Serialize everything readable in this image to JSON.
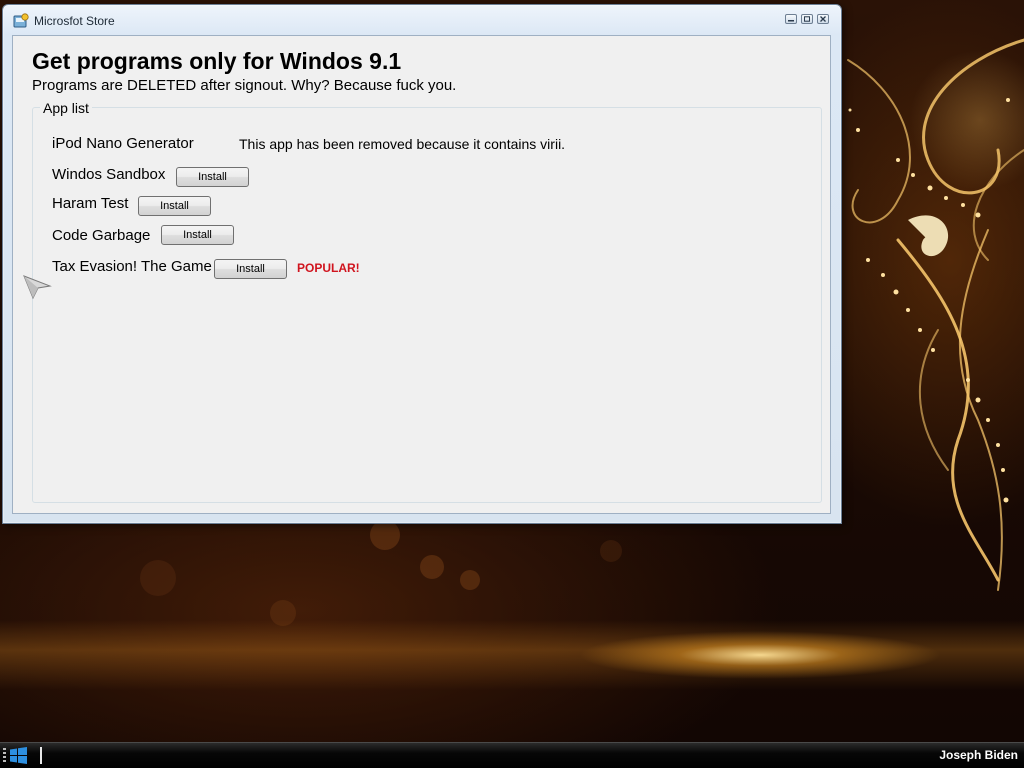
{
  "window": {
    "title": "Microsfot Store",
    "heading": "Get programs only for Windos 9.1",
    "subheading": "Programs are DELETED after signout. Why? Because fuck you.",
    "group_label": "App list"
  },
  "apps": [
    {
      "name": "iPod Nano Generator",
      "note": "This app has been removed because it contains virii."
    },
    {
      "name": "Windos Sandbox",
      "install_label": "Install"
    },
    {
      "name": "Haram Test",
      "install_label": "Install"
    },
    {
      "name": "Code Garbage",
      "install_label": "Install"
    },
    {
      "name": "Tax Evasion! The Game",
      "install_label": "Install",
      "badge": "POPULAR!"
    }
  ],
  "taskbar": {
    "user_name": "Joseph Biden"
  },
  "icons": {
    "app": "store-icon",
    "minimize": "minimize-icon",
    "maximize": "maximize-icon",
    "close": "close-icon",
    "start": "windows-logo-icon",
    "cursor": "pointer-cursor-icon"
  },
  "colors": {
    "popular_badge": "#d0141e",
    "window_frame": "#dce8f5",
    "client_bg": "#f0f0f0"
  }
}
